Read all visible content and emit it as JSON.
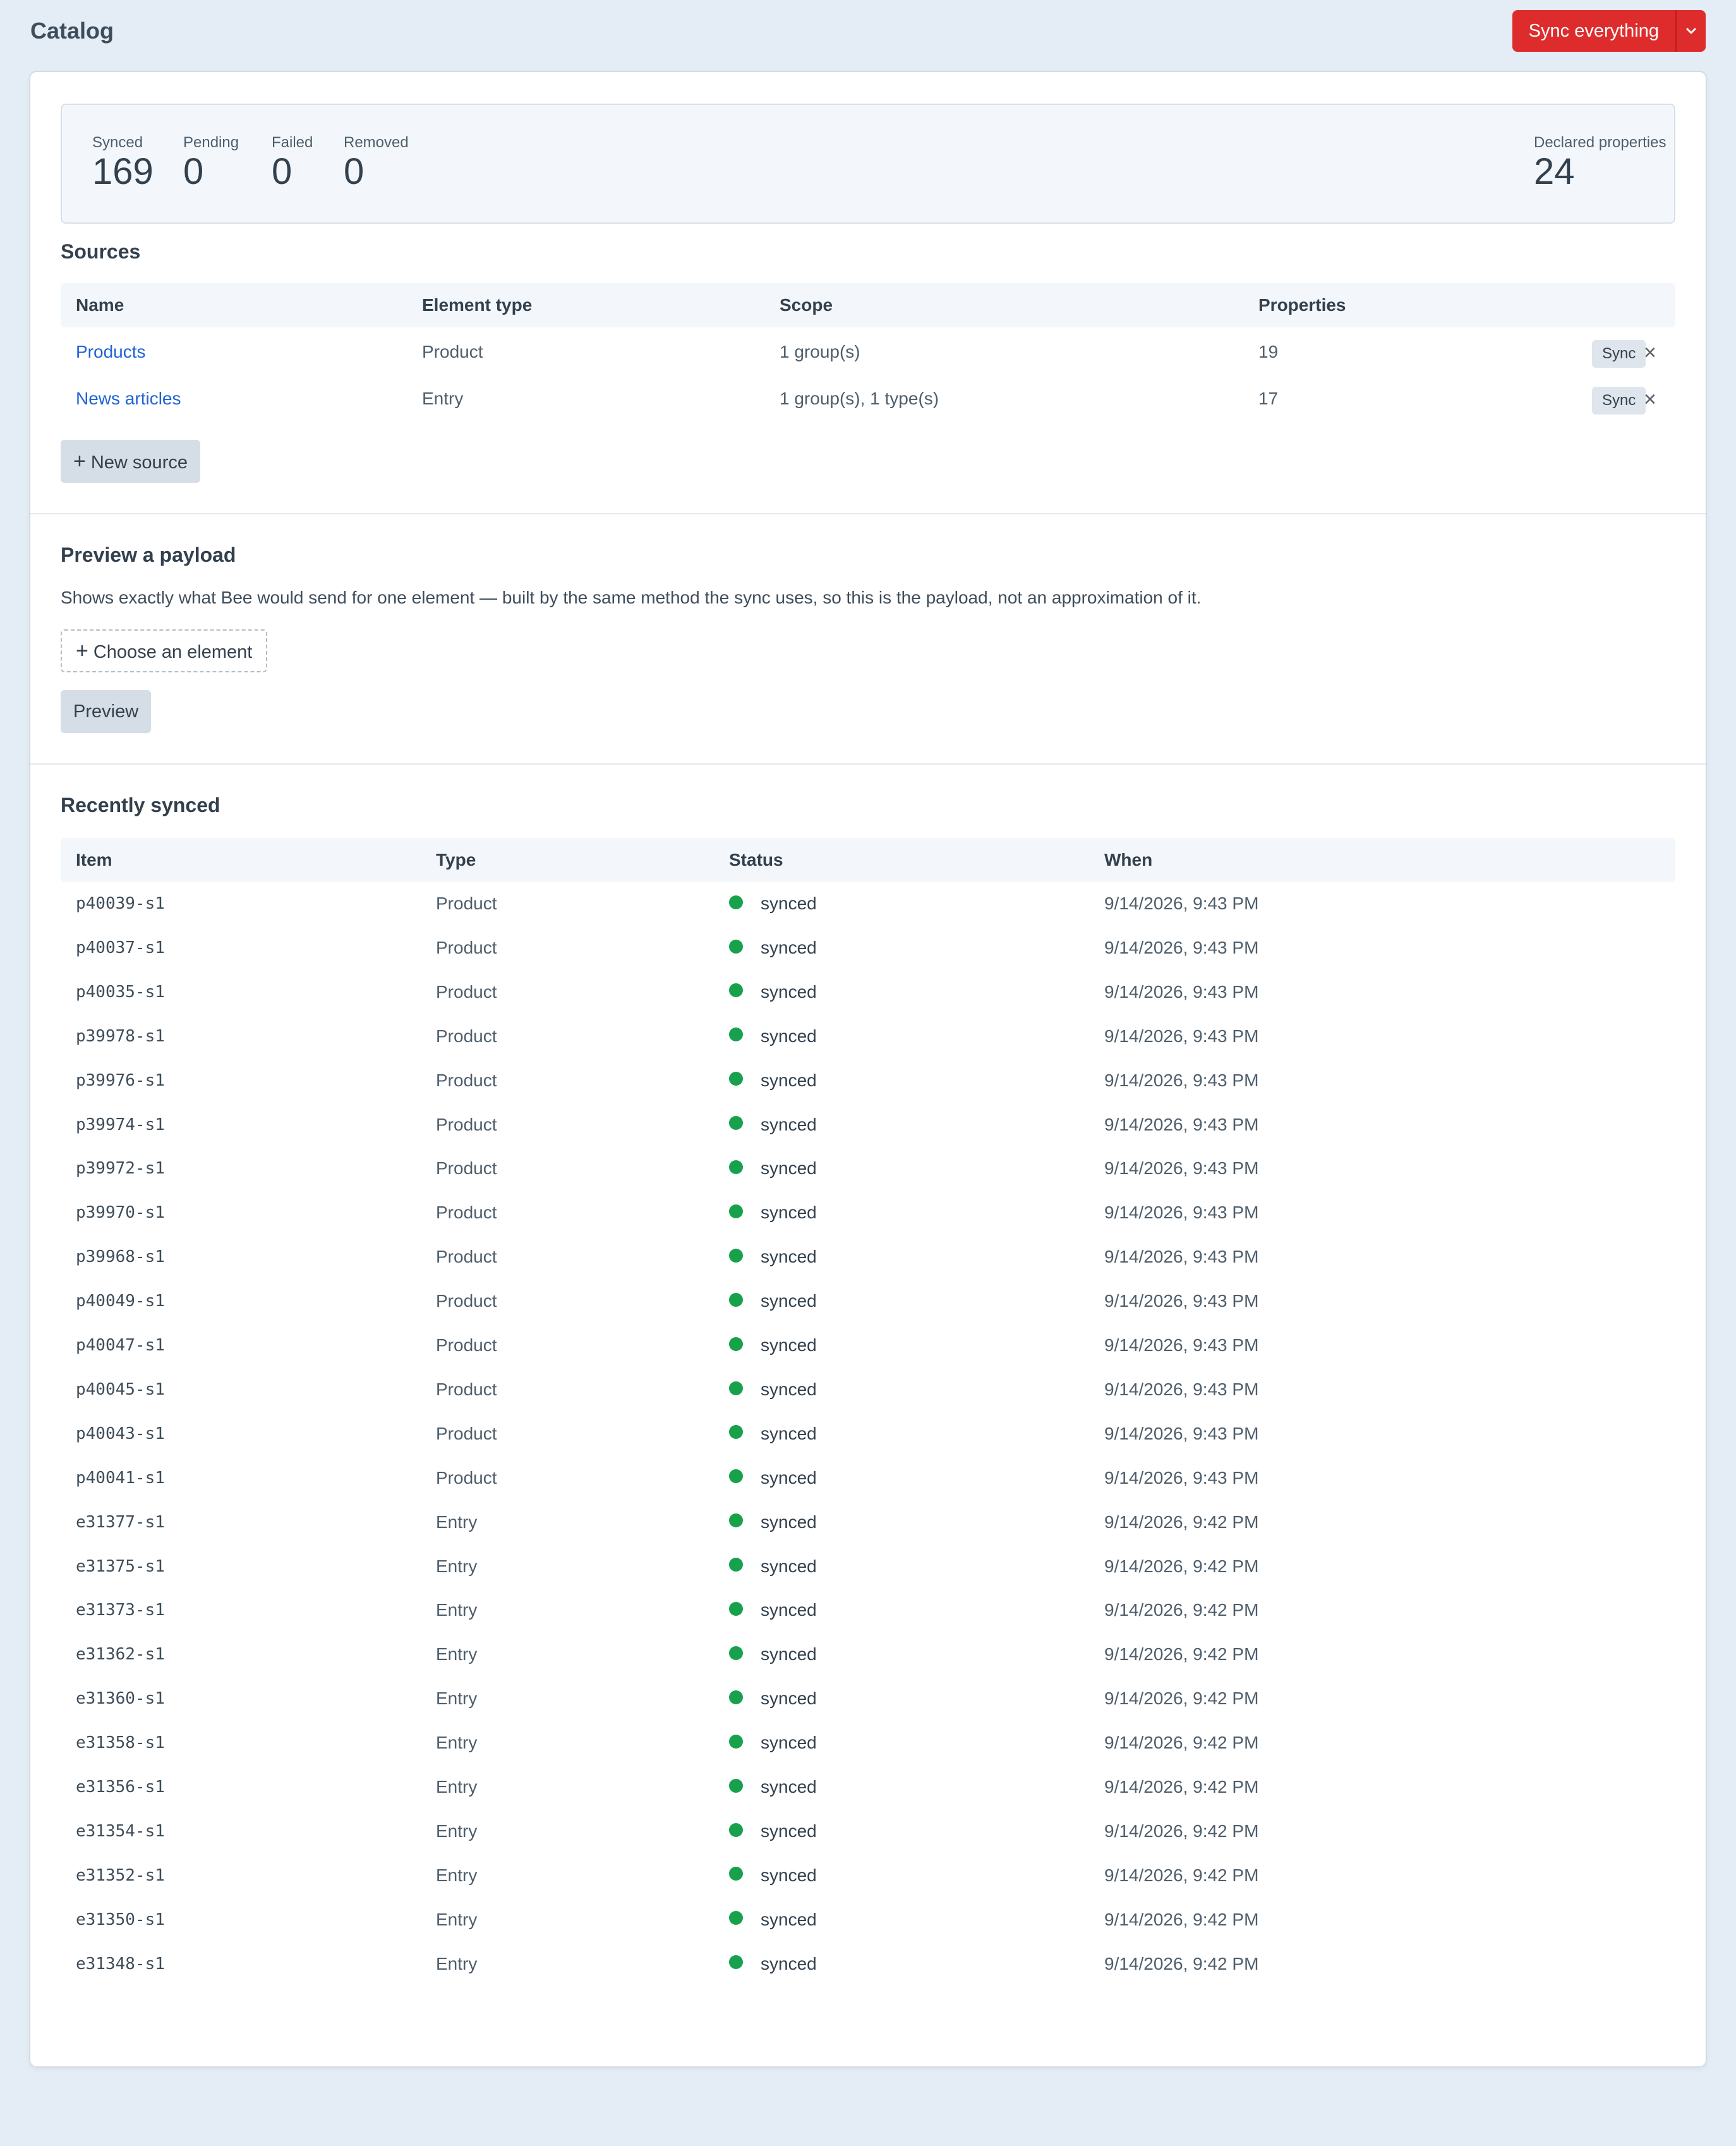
{
  "header": {
    "title": "Catalog",
    "sync_button": "Sync everything",
    "sync_menu_icon": "chevron-down-icon",
    "accent_color": "#de2c2c"
  },
  "stats": {
    "synced_label": "Synced",
    "synced_value": "169",
    "pending_label": "Pending",
    "pending_value": "0",
    "failed_label": "Failed",
    "failed_value": "0",
    "removed_label": "Removed",
    "removed_value": "0",
    "declared_label": "Declared properties",
    "declared_value": "24"
  },
  "sources": {
    "title": "Sources",
    "columns": [
      "Name",
      "Element type",
      "Scope",
      "Properties"
    ],
    "rows": [
      {
        "name": "Products",
        "element_type": "Product",
        "scope": "1 group(s)",
        "properties": "19",
        "sync_label": "Sync"
      },
      {
        "name": "News articles",
        "element_type": "Entry",
        "scope": "1 group(s), 1 type(s)",
        "properties": "17",
        "sync_label": "Sync"
      }
    ],
    "remove_icon": "close-icon",
    "new_source_label": "New source"
  },
  "preview": {
    "title": "Preview a payload",
    "description": "Shows exactly what Bee would send for one element — built by the same method the sync uses, so this is the payload, not an approximation of it.",
    "choose_label": "Choose an element",
    "preview_label": "Preview"
  },
  "recent": {
    "title": "Recently synced",
    "columns": [
      "Item",
      "Type",
      "Status",
      "When"
    ],
    "status_color": "#18a14d",
    "rows": [
      {
        "item": "p40039-s1",
        "type": "Product",
        "status": "synced",
        "when": "9/14/2026, 9:43 PM"
      },
      {
        "item": "p40037-s1",
        "type": "Product",
        "status": "synced",
        "when": "9/14/2026, 9:43 PM"
      },
      {
        "item": "p40035-s1",
        "type": "Product",
        "status": "synced",
        "when": "9/14/2026, 9:43 PM"
      },
      {
        "item": "p39978-s1",
        "type": "Product",
        "status": "synced",
        "when": "9/14/2026, 9:43 PM"
      },
      {
        "item": "p39976-s1",
        "type": "Product",
        "status": "synced",
        "when": "9/14/2026, 9:43 PM"
      },
      {
        "item": "p39974-s1",
        "type": "Product",
        "status": "synced",
        "when": "9/14/2026, 9:43 PM"
      },
      {
        "item": "p39972-s1",
        "type": "Product",
        "status": "synced",
        "when": "9/14/2026, 9:43 PM"
      },
      {
        "item": "p39970-s1",
        "type": "Product",
        "status": "synced",
        "when": "9/14/2026, 9:43 PM"
      },
      {
        "item": "p39968-s1",
        "type": "Product",
        "status": "synced",
        "when": "9/14/2026, 9:43 PM"
      },
      {
        "item": "p40049-s1",
        "type": "Product",
        "status": "synced",
        "when": "9/14/2026, 9:43 PM"
      },
      {
        "item": "p40047-s1",
        "type": "Product",
        "status": "synced",
        "when": "9/14/2026, 9:43 PM"
      },
      {
        "item": "p40045-s1",
        "type": "Product",
        "status": "synced",
        "when": "9/14/2026, 9:43 PM"
      },
      {
        "item": "p40043-s1",
        "type": "Product",
        "status": "synced",
        "when": "9/14/2026, 9:43 PM"
      },
      {
        "item": "p40041-s1",
        "type": "Product",
        "status": "synced",
        "when": "9/14/2026, 9:43 PM"
      },
      {
        "item": "e31377-s1",
        "type": "Entry",
        "status": "synced",
        "when": "9/14/2026, 9:42 PM"
      },
      {
        "item": "e31375-s1",
        "type": "Entry",
        "status": "synced",
        "when": "9/14/2026, 9:42 PM"
      },
      {
        "item": "e31373-s1",
        "type": "Entry",
        "status": "synced",
        "when": "9/14/2026, 9:42 PM"
      },
      {
        "item": "e31362-s1",
        "type": "Entry",
        "status": "synced",
        "when": "9/14/2026, 9:42 PM"
      },
      {
        "item": "e31360-s1",
        "type": "Entry",
        "status": "synced",
        "when": "9/14/2026, 9:42 PM"
      },
      {
        "item": "e31358-s1",
        "type": "Entry",
        "status": "synced",
        "when": "9/14/2026, 9:42 PM"
      },
      {
        "item": "e31356-s1",
        "type": "Entry",
        "status": "synced",
        "when": "9/14/2026, 9:42 PM"
      },
      {
        "item": "e31354-s1",
        "type": "Entry",
        "status": "synced",
        "when": "9/14/2026, 9:42 PM"
      },
      {
        "item": "e31352-s1",
        "type": "Entry",
        "status": "synced",
        "when": "9/14/2026, 9:42 PM"
      },
      {
        "item": "e31350-s1",
        "type": "Entry",
        "status": "synced",
        "when": "9/14/2026, 9:42 PM"
      },
      {
        "item": "e31348-s1",
        "type": "Entry",
        "status": "synced",
        "when": "9/14/2026, 9:42 PM"
      }
    ]
  }
}
